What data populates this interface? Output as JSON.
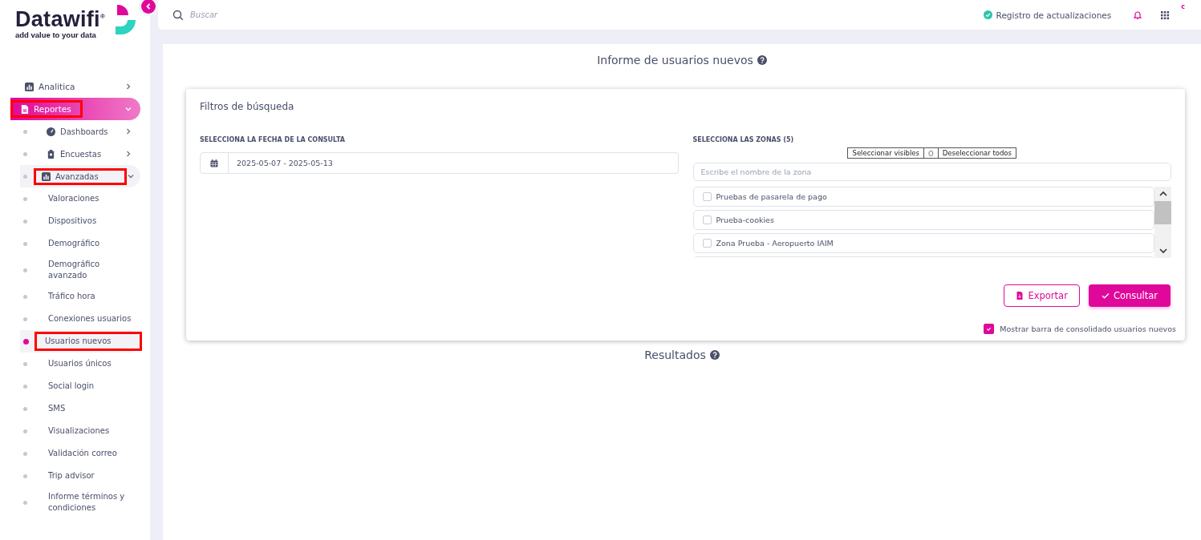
{
  "logo": {
    "name": "Datawifi",
    "mark": "®",
    "tagline": "add value to your data"
  },
  "sidebar": {
    "items": [
      {
        "label": "Analitica",
        "kind": "chart",
        "expanded": false,
        "selected": false,
        "highlighted": false
      },
      {
        "label": "Reportes",
        "kind": "report",
        "expanded": true,
        "selected": true,
        "highlighted": true,
        "children": [
          {
            "label": "Dashboards",
            "kind": "gauge",
            "expanded": false,
            "selected": false,
            "highlighted": false
          },
          {
            "label": "Encuestas",
            "kind": "survey",
            "expanded": false,
            "selected": false,
            "highlighted": false
          },
          {
            "label": "Avanzadas",
            "kind": "chart",
            "expanded": true,
            "selected": true,
            "highlighted": true,
            "children": [
              {
                "label": "Valoraciones",
                "selected": false,
                "highlighted": false
              },
              {
                "label": "Dispositivos",
                "selected": false,
                "highlighted": false
              },
              {
                "label": "Demográfico",
                "selected": false,
                "highlighted": false
              },
              {
                "label": "Demográfico avanzado",
                "selected": false,
                "highlighted": false
              },
              {
                "label": "Tráfico hora",
                "selected": false,
                "highlighted": false
              },
              {
                "label": "Conexiones usuarios",
                "selected": false,
                "highlighted": false
              },
              {
                "label": "Usuarios nuevos",
                "selected": true,
                "highlighted": true
              },
              {
                "label": "Usuarios únicos",
                "selected": false,
                "highlighted": false
              },
              {
                "label": "Social login",
                "selected": false,
                "highlighted": false
              },
              {
                "label": "SMS",
                "selected": false,
                "highlighted": false
              },
              {
                "label": "Visualizaciones",
                "selected": false,
                "highlighted": false
              },
              {
                "label": "Validación correo",
                "selected": false,
                "highlighted": false
              },
              {
                "label": "Trip advisor",
                "selected": false,
                "highlighted": false
              },
              {
                "label": "Informe términos y condiciones",
                "selected": false,
                "highlighted": false
              }
            ]
          }
        ]
      }
    ]
  },
  "topbar": {
    "search": {
      "placeholder": "Buscar"
    },
    "changelog": "Registro de actualizaciones",
    "badge": "c"
  },
  "page": {
    "title": "Informe de usuarios nuevos",
    "filters": {
      "title": "Filtros de búsqueda",
      "date": {
        "label": "SELECCIONA LA FECHA DE LA CONSULTA",
        "value": "2025-05-07 - 2025-05-13"
      },
      "zones": {
        "label": "SELECCIONA LAS ZONAS (5)",
        "select_visible": "Seleccionar visibles",
        "separator": "O",
        "deselect_all": "Deseleccionar todos",
        "search_placeholder": "Escribe el nombre de la zona",
        "items": [
          {
            "label": "Pruebas de pasarela de pago",
            "checked": false
          },
          {
            "label": "Prueba-cookies",
            "checked": false
          },
          {
            "label": "Zona Prueba - Aeropuerto IAIM",
            "checked": false
          }
        ]
      },
      "buttons": {
        "export": "Exportar",
        "submit": "Consultar"
      },
      "consolidated": {
        "label": "Mostrar barra de consolidado usuarios nuevos",
        "checked": true
      }
    },
    "results_title": "Resultados"
  }
}
